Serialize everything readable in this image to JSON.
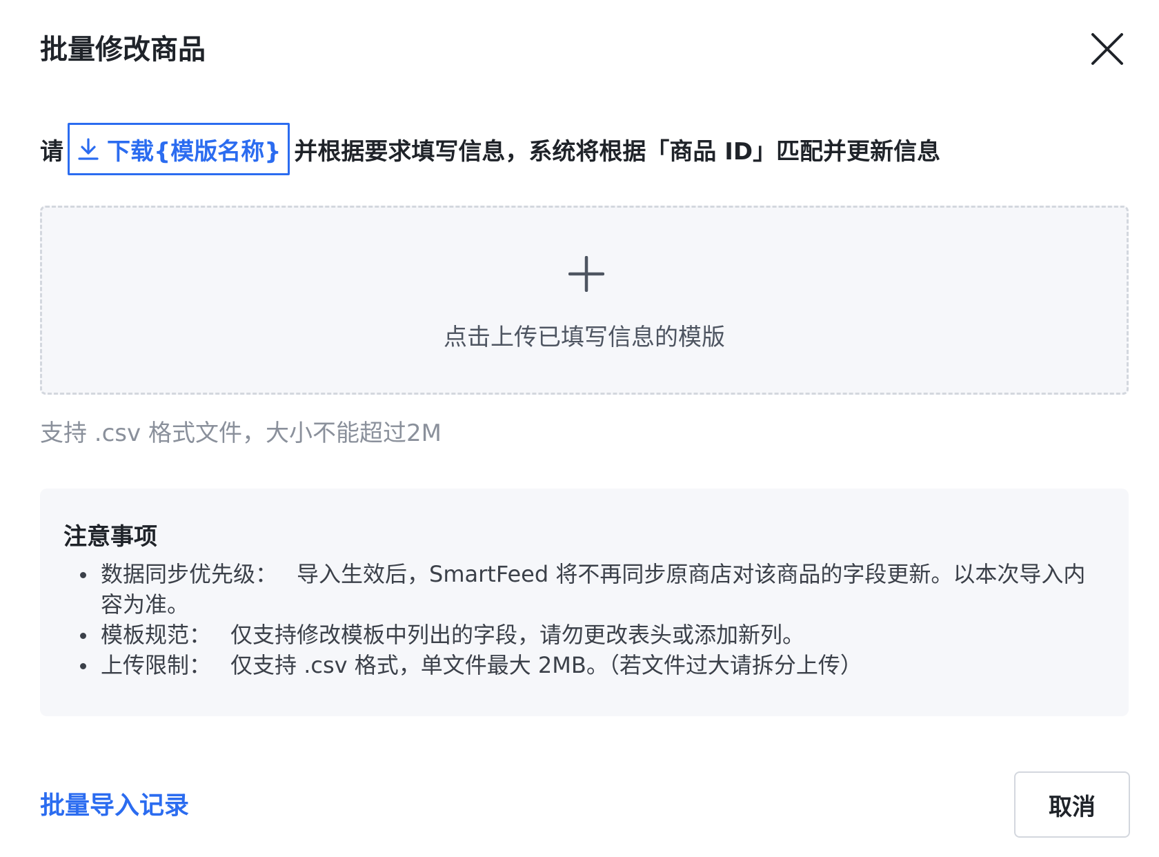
{
  "dialog": {
    "title": "批量修改商品"
  },
  "instruction": {
    "prefix": "请",
    "download_label": "下载{模版名称}",
    "suffix": "并根据要求填写信息，系统将根据「商品 ID」匹配并更新信息"
  },
  "upload": {
    "prompt": "点击上传已填写信息的模版",
    "hint": "支持 .csv 格式文件，大小不能超过2M"
  },
  "notes": {
    "title": "注意事项",
    "items": [
      {
        "label": "数据同步优先级：",
        "text": "导入生效后，SmartFeed 将不再同步原商店对该商品的字段更新。以本次导入内容为准。"
      },
      {
        "label": "模板规范：",
        "text": "仅支持修改模板中列出的字段，请勿更改表头或添加新列。"
      },
      {
        "label": "上传限制：",
        "text": "仅支持 .csv 格式，单文件最大 2MB。（若文件过大请拆分上传）"
      }
    ]
  },
  "footer": {
    "history_link": "批量导入记录",
    "cancel_label": "取消"
  },
  "colors": {
    "accent": "#2b6cf0",
    "text_primary": "#1f2329",
    "text_secondary": "#8a909b",
    "panel_bg": "#f6f7fa"
  },
  "icons": {
    "close": "close-icon",
    "download": "download-icon",
    "upload": "plus-icon"
  }
}
